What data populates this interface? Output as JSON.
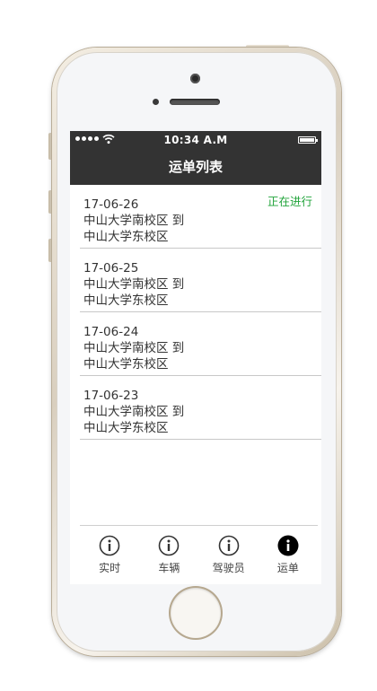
{
  "status_bar": {
    "time": "10:34 A.M"
  },
  "nav": {
    "title": "运单列表"
  },
  "orders": [
    {
      "date": "17-06-26",
      "from": "中山大学南校区 到",
      "to": "中山大学东校区",
      "status": "正在进行"
    },
    {
      "date": "17-06-25",
      "from": "中山大学南校区 到",
      "to": "中山大学东校区",
      "status": ""
    },
    {
      "date": "17-06-24",
      "from": "中山大学南校区 到",
      "to": "中山大学东校区",
      "status": ""
    },
    {
      "date": "17-06-23",
      "from": "中山大学南校区 到",
      "to": "中山大学东校区",
      "status": ""
    }
  ],
  "tabs": [
    {
      "label": "实时",
      "icon": "info-icon",
      "active": false
    },
    {
      "label": "车辆",
      "icon": "info-icon",
      "active": false
    },
    {
      "label": "驾驶员",
      "icon": "info-icon",
      "active": false
    },
    {
      "label": "运单",
      "icon": "info-icon",
      "active": true
    }
  ],
  "colors": {
    "header_bg": "#333333",
    "status_in_progress": "#20a33a",
    "tab_inactive": "#444444",
    "tab_active": "#000000"
  }
}
